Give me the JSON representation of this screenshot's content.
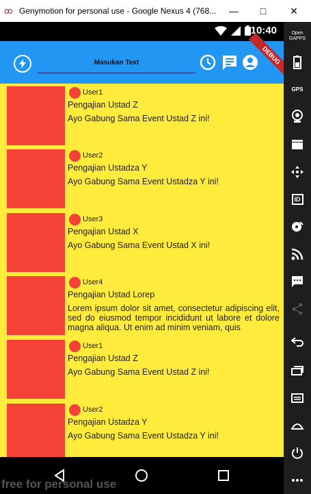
{
  "window": {
    "title": "Genymotion for personal use - Google Nexus 4 (768...",
    "minimize": "—",
    "maximize": "□",
    "close": "✕"
  },
  "statusbar": {
    "time": "10:40"
  },
  "appbar": {
    "search_placeholder": "Masukan Text",
    "debug_label": "DEBUG"
  },
  "items": [
    {
      "user": "User1",
      "title": "Pengajian Ustad Z",
      "desc": "Ayo Gabung Sama Event Ustad Z ini!"
    },
    {
      "user": "User2",
      "title": "Pengajian Ustadza Y",
      "desc": "Ayo Gabung Sama Event Ustadza Y ini!"
    },
    {
      "user": "User3",
      "title": "Pengajian Ustad X",
      "desc": "Ayo Gabung Sama Event Ustad X ini!"
    },
    {
      "user": "User4",
      "title": "Pengajian Ustad Lorep",
      "desc": "Lorem ipsum dolor sit amet, consectetur adipiscing elit, sed do eiusmod tempor incididunt ut labore et dolore magna aliqua. Ut enim ad minim veniam, quis"
    },
    {
      "user": "User1",
      "title": "Pengajian Ustad Z",
      "desc": "Ayo Gabung Sama Event Ustad Z ini!"
    },
    {
      "user": "User2",
      "title": "Pengajian Ustadza Y",
      "desc": "Ayo Gabung Sama Event Ustadza Y ini!"
    }
  ],
  "sidebar": {
    "open_gapps": "Open GAPPS",
    "gps": "GPS",
    "id": "ID"
  },
  "watermark": "free for personal use"
}
